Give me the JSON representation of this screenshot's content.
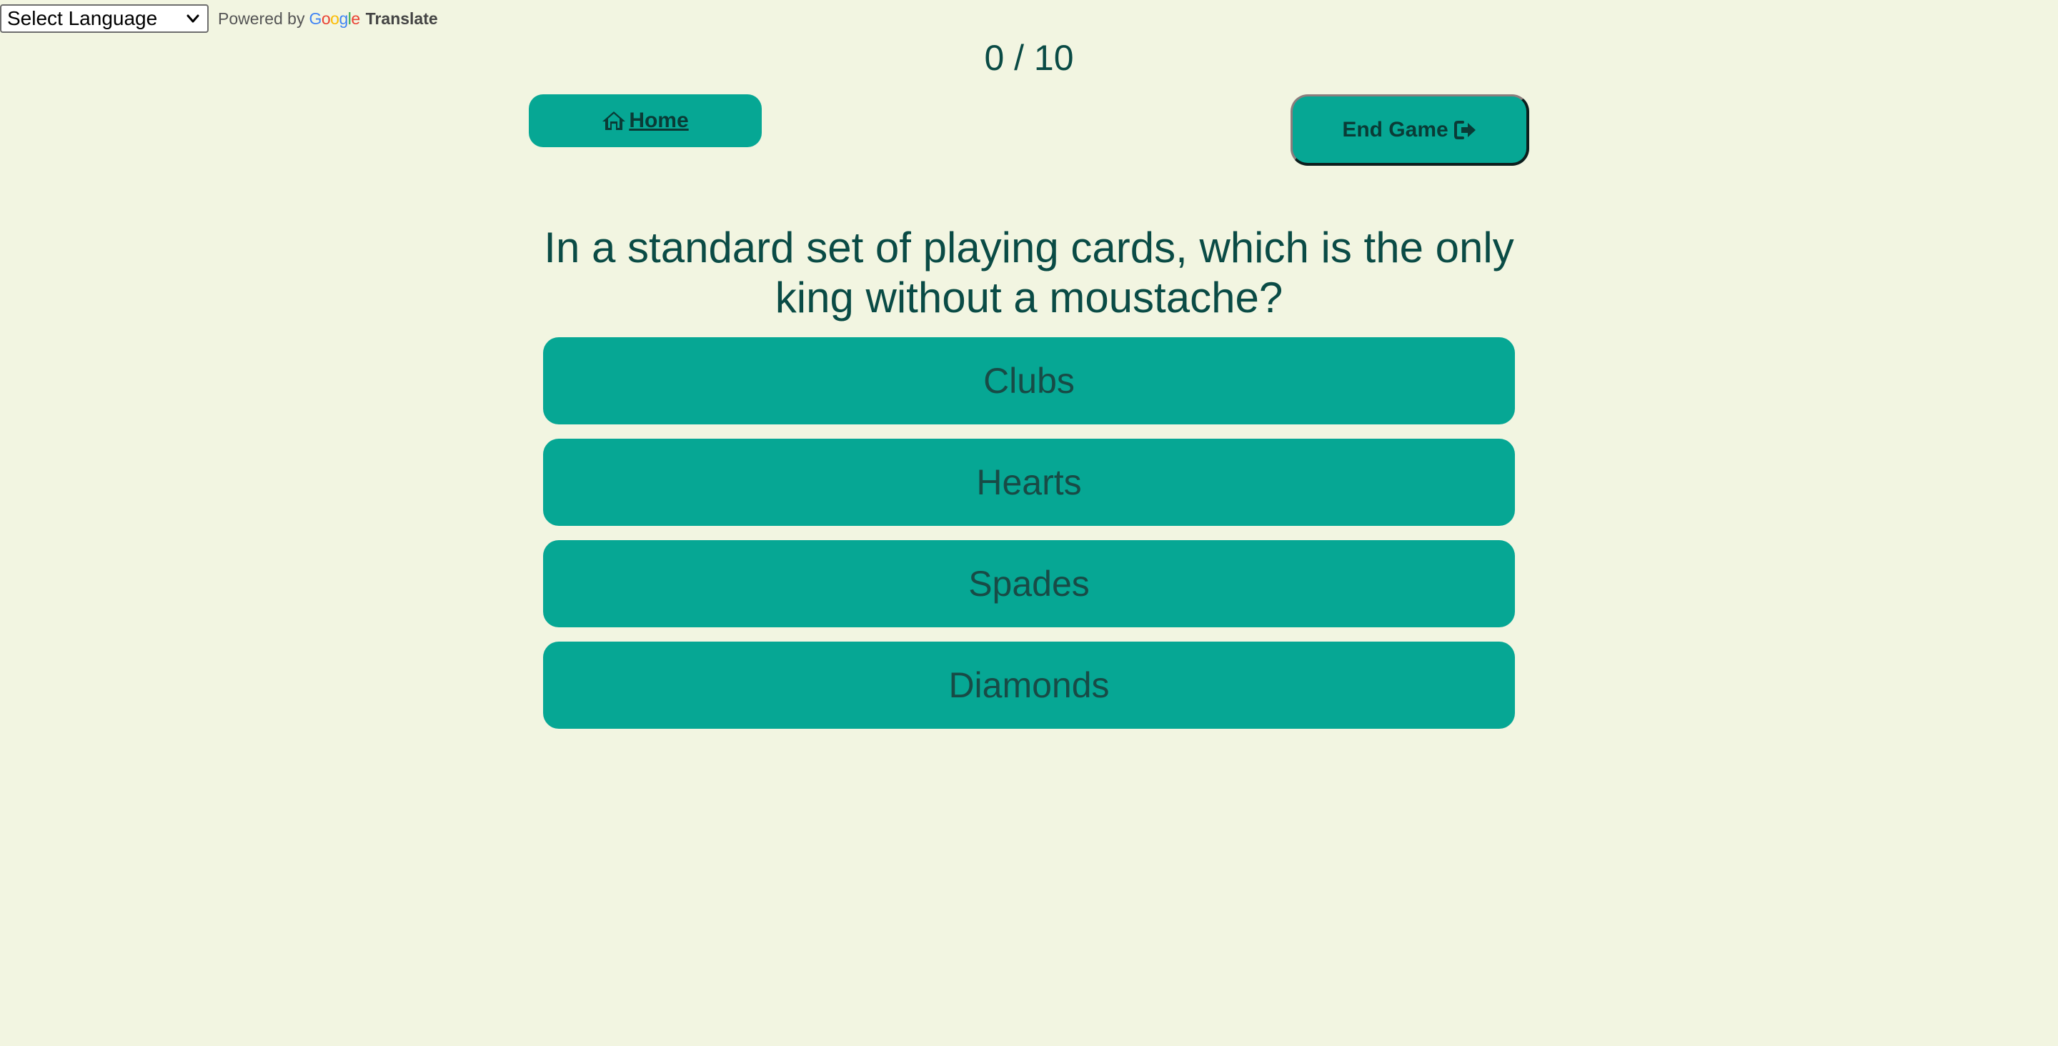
{
  "translate": {
    "select_label": "Select Language",
    "powered_by": "Powered by",
    "google_letters": [
      "G",
      "o",
      "o",
      "g",
      "l",
      "e"
    ],
    "google_colors": [
      "#4285f4",
      "#ea4335",
      "#fbbc05",
      "#4285f4",
      "#34a853",
      "#ea4335"
    ],
    "translate_word": "Translate"
  },
  "score": "0 / 10",
  "buttons": {
    "home_label": " Home",
    "end_label": "End Game"
  },
  "question": "In a standard set of playing cards, which is the only king without a moustache?",
  "answers": [
    {
      "label": "Clubs"
    },
    {
      "label": "Hearts"
    },
    {
      "label": "Spades"
    },
    {
      "label": "Diamonds"
    }
  ],
  "icons": {
    "home": "home-icon",
    "end_game": "sign-out-icon",
    "select": "chevron-down-icon"
  },
  "colors": {
    "background": "#f2f5e1",
    "accent": "#06a794",
    "text": "#0a4b45"
  }
}
